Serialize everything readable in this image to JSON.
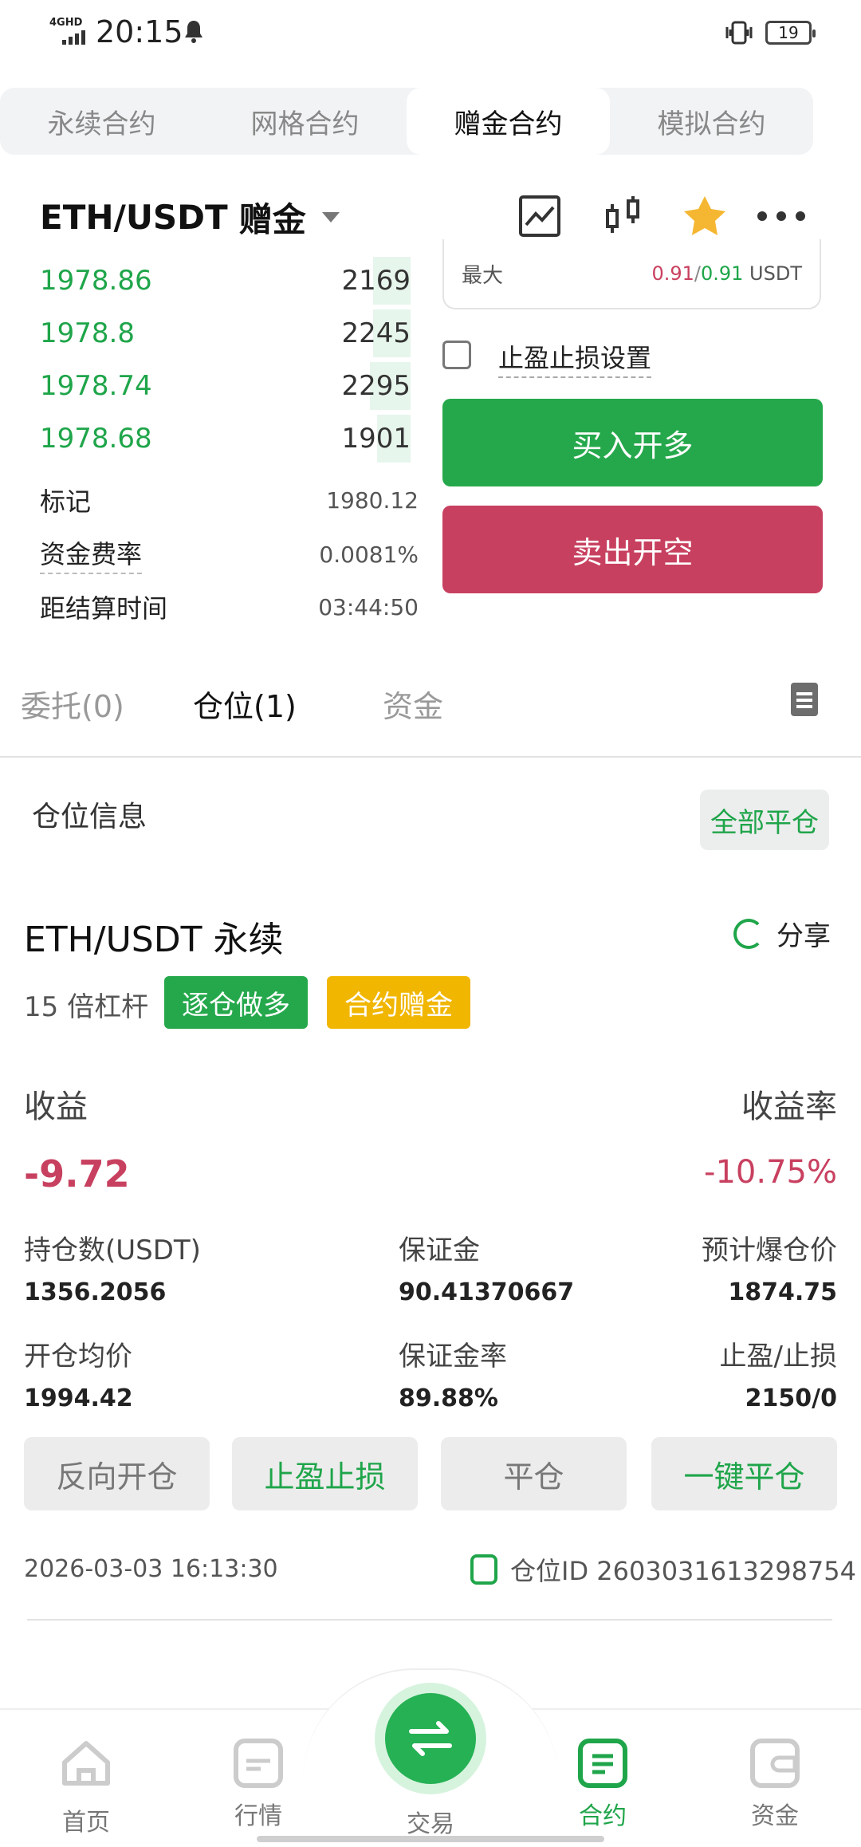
{
  "status": {
    "time": "20:15",
    "network": "4GHD",
    "battery": "19"
  },
  "segment_tabs": [
    "永续合约",
    "网格合约",
    "赠金合约",
    "模拟合约"
  ],
  "header": {
    "pair": "ETH/USDT",
    "tag": "赠金"
  },
  "orderbook": [
    {
      "price": "1978.86",
      "amount": "2169",
      "depth": 0.1
    },
    {
      "price": "1978.8",
      "amount": "2245",
      "depth": 0.1
    },
    {
      "price": "1978.74",
      "amount": "2295",
      "depth": 0.11
    },
    {
      "price": "1978.68",
      "amount": "1901",
      "depth": 0.09
    }
  ],
  "market_info": {
    "mark_label": "标记",
    "mark_value": "1980.12",
    "funding_label": "资金费率",
    "funding_value": "0.0081%",
    "settle_label": "距结算时间",
    "settle_value": "03:44:50"
  },
  "order_form": {
    "max_label": "最大",
    "max_a": "0.91",
    "max_sep": "/",
    "max_b": "0.91",
    "max_unit": "USDT",
    "tpsl_label": "止盈止损设置",
    "buy_label": "买入开多",
    "sell_label": "卖出开空"
  },
  "sub_tabs": {
    "orders": "委托(0)",
    "positions": "仓位(1)",
    "funds": "资金"
  },
  "position": {
    "section_title": "仓位信息",
    "close_all": "全部平仓",
    "name": "ETH/USDT 永续",
    "share": "分享",
    "leverage": "15 倍杠杆",
    "tag_mode": "逐仓做多",
    "tag_bonus": "合约赠金",
    "pnl_label": "收益",
    "pnl_rate_label": "收益率",
    "pnl": "-9.72",
    "pnl_rate": "-10.75%",
    "size_label": "持仓数(USDT)",
    "size_value": "1356.2056",
    "margin_label": "保证金",
    "margin_value": "90.41370667",
    "liq_label": "预计爆仓价",
    "liq_value": "1874.75",
    "entry_label": "开仓均价",
    "entry_value": "1994.42",
    "margin_rate_label": "保证金率",
    "margin_rate_value": "89.88%",
    "tpsl_label": "止盈/止损",
    "tpsl_value": "2150/0",
    "actions": [
      "反向开仓",
      "止盈止损",
      "平仓",
      "一键平仓"
    ],
    "time": "2026-03-03 16:13:30",
    "position_id": "仓位ID 2603031613298754"
  },
  "nav": [
    "首页",
    "行情",
    "交易",
    "合约",
    "资金"
  ],
  "colors": {
    "green": "#25a84c",
    "red": "#c8405f",
    "yellow": "#f1b600"
  }
}
